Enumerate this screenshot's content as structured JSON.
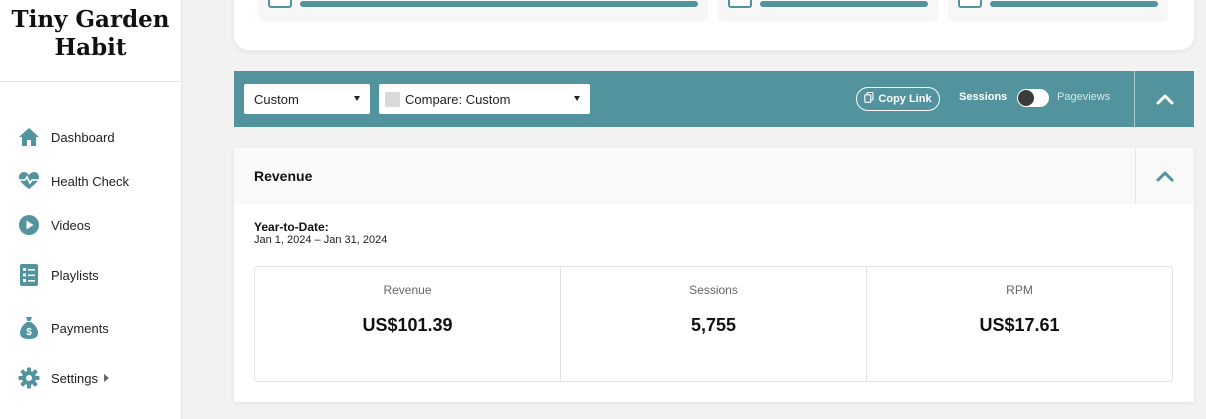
{
  "brand": {
    "line1": "Tiny Garden",
    "line2": "Habit"
  },
  "sidebar": {
    "items": [
      {
        "label": "Dashboard",
        "icon": "home-icon"
      },
      {
        "label": "Health Check",
        "icon": "heartbeat-icon"
      },
      {
        "label": "Videos",
        "icon": "play-icon"
      },
      {
        "label": "Playlists",
        "icon": "checklist-icon"
      },
      {
        "label": "Payments",
        "icon": "money-bag-icon"
      },
      {
        "label": "Settings",
        "icon": "gear-icon"
      }
    ]
  },
  "toolbar": {
    "range_select": "Custom",
    "compare_select": "Compare: Custom",
    "copy_link": "Copy Link",
    "toggle_left": "Sessions",
    "toggle_right": "Pageviews"
  },
  "revenue_panel": {
    "title": "Revenue",
    "period_label": "Year-to-Date:",
    "period_range": "Jan 1, 2024 – Jan 31, 2024",
    "stats": [
      {
        "label": "Revenue",
        "value": "US$101.39"
      },
      {
        "label": "Sessions",
        "value": "5,755"
      },
      {
        "label": "RPM",
        "value": "US$17.61"
      }
    ]
  },
  "colors": {
    "accent": "#52939d",
    "background": "#f2f2f2"
  }
}
